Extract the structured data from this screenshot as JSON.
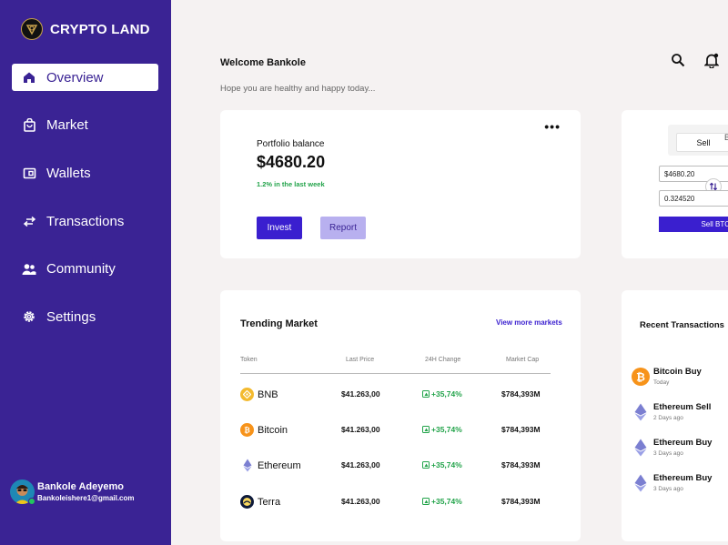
{
  "brand": {
    "name": "CRYPTO LAND"
  },
  "nav": [
    {
      "label": "Overview",
      "icon": "home-icon",
      "active": true
    },
    {
      "label": "Market",
      "icon": "shopping-bag-icon"
    },
    {
      "label": "Wallets",
      "icon": "wallet-icon"
    },
    {
      "label": "Transactions",
      "icon": "arrows-exchange-icon"
    },
    {
      "label": "Community",
      "icon": "people-icon"
    },
    {
      "label": "Settings",
      "icon": "gear-icon"
    }
  ],
  "user": {
    "name": "Bankole Adeyemo",
    "email": "Bankoleishere1@gmail.com"
  },
  "header": {
    "welcome": "Welcome Bankole",
    "greeting": "Hope you are healthy and happy today..."
  },
  "portfolio": {
    "label": "Portfolio balance",
    "value": "$4680.20",
    "change": "1.2% in the last week",
    "invest_label": "Invest",
    "report_label": "Report"
  },
  "trade": {
    "sell_tab": "Sell",
    "buy_tab": "B",
    "amount_usd": "$4680.20",
    "amount_crypto": "0.324520",
    "sell_button": "Sell BTC"
  },
  "trending": {
    "title": "Trending Market",
    "view_more": "View more markets",
    "columns": [
      "Token",
      "Last Price",
      "24H Change",
      "Market Cap"
    ],
    "rows": [
      {
        "token": "BNB",
        "price": "$41.263,00",
        "change": "+35,74%",
        "cap": "$784,393M"
      },
      {
        "token": "Bitcoin",
        "price": "$41.263,00",
        "change": "+35,74%",
        "cap": "$784,393M"
      },
      {
        "token": "Ethereum",
        "price": "$41.263,00",
        "change": "+35,74%",
        "cap": "$784,393M"
      },
      {
        "token": "Terra",
        "price": "$41.263,00",
        "change": "+35,74%",
        "cap": "$784,393M"
      }
    ]
  },
  "recent": {
    "title": "Recent Transactions",
    "items": [
      {
        "name": "Bitcoin Buy",
        "time": "Today"
      },
      {
        "name": "Ethereum Sell",
        "time": "2 Days ago"
      },
      {
        "name": "Ethereum Buy",
        "time": "3 Days ago"
      },
      {
        "name": "Ethereum Buy",
        "time": "3 Days ago"
      }
    ]
  },
  "colors": {
    "sidebar": "#3a2394",
    "accent": "#3a1fcf",
    "positive": "#22a34a",
    "background": "#f5f2f2"
  }
}
